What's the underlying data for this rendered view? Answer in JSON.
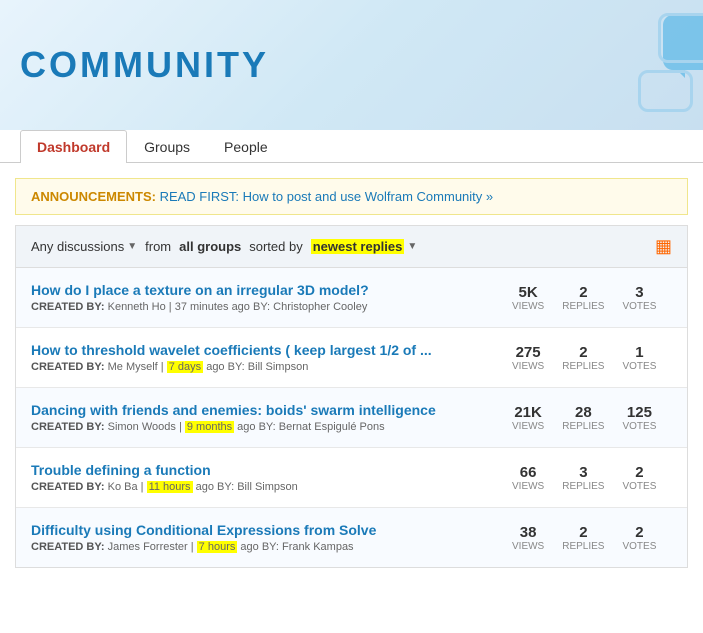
{
  "header": {
    "title": "COMMUNITY"
  },
  "nav": {
    "tabs": [
      {
        "id": "dashboard",
        "label": "Dashboard",
        "active": true
      },
      {
        "id": "groups",
        "label": "Groups",
        "active": false
      },
      {
        "id": "people",
        "label": "People",
        "active": false
      }
    ]
  },
  "announcement": {
    "label": "ANNOUNCEMENTS:",
    "text": "READ FIRST: How to post and use Wolfram Community »"
  },
  "filter": {
    "any_discussions": "Any discussions",
    "from_text": "from",
    "all_groups": "all groups",
    "sorted_by_text": "sorted by",
    "newest_replies": "newest replies"
  },
  "discussions": [
    {
      "title": "How do I place a texture on an irregular 3D model?",
      "created_by_label": "CREATED BY:",
      "author": "Kenneth Ho",
      "separator": "|",
      "time": "37 minutes ago",
      "by_label": "BY:",
      "commenter": "Christopher Cooley",
      "time_highlight": false,
      "views": "5K",
      "views_label": "VIEWS",
      "replies": "2",
      "replies_label": "REPLIES",
      "votes": "3",
      "votes_label": "VOTES"
    },
    {
      "title": "How to threshold wavelet coefficients ( keep largest 1/2 of ...",
      "created_by_label": "CREATED BY:",
      "author": "Me Myself",
      "separator": "|",
      "time": "7 days",
      "time_suffix": " ago",
      "by_label": "BY:",
      "commenter": "Bill Simpson",
      "time_highlight": true,
      "views": "275",
      "views_label": "VIEWS",
      "replies": "2",
      "replies_label": "REPLIES",
      "votes": "1",
      "votes_label": "VOTES"
    },
    {
      "title": "Dancing with friends and enemies: boids' swarm intelligence",
      "created_by_label": "CREATED BY:",
      "author": "Simon Woods",
      "separator": "|",
      "time": "9 months",
      "time_suffix": " ago",
      "by_label": "BY:",
      "commenter": "Bernat Espigulé Pons",
      "time_highlight": true,
      "views": "21K",
      "views_label": "VIEWS",
      "replies": "28",
      "replies_label": "REPLIES",
      "votes": "125",
      "votes_label": "VOTES"
    },
    {
      "title": "Trouble defining a function",
      "created_by_label": "CREATED BY:",
      "author": "Ko Ba",
      "separator": "|",
      "time": "11 hours",
      "time_suffix": " ago",
      "by_label": "BY:",
      "commenter": "Bill Simpson",
      "time_highlight": true,
      "views": "66",
      "views_label": "VIEWS",
      "replies": "3",
      "replies_label": "REPLIES",
      "votes": "2",
      "votes_label": "VOTES"
    },
    {
      "title": "Difficulty using Conditional Expressions from Solve",
      "created_by_label": "CREATED BY:",
      "author": "James Forrester",
      "separator": "|",
      "time": "7 hours",
      "time_suffix": " ago",
      "by_label": "BY:",
      "commenter": "Frank Kampas",
      "time_highlight": true,
      "views": "38",
      "views_label": "VIEWS",
      "replies": "2",
      "replies_label": "REPLIES",
      "votes": "2",
      "votes_label": "VOTES"
    }
  ]
}
